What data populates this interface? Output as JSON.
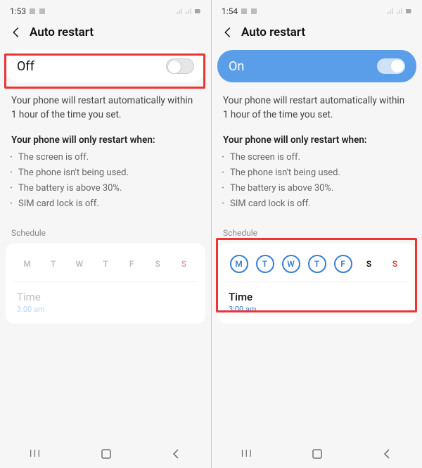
{
  "left": {
    "status_time": "1:53",
    "header_title": "Auto restart",
    "toggle_label": "Off",
    "desc": "Your phone will restart automatically within 1 hour of the time you set.",
    "subhead": "Your phone will only restart when:",
    "bullets": [
      "The screen is off.",
      "The phone isn't being used.",
      "The battery is above 30%.",
      "SIM card lock is off."
    ],
    "sched_label": "Schedule",
    "days": [
      "M",
      "T",
      "W",
      "T",
      "F",
      "S",
      "S"
    ],
    "time_label": "Time",
    "time_value": "3:00 am"
  },
  "right": {
    "status_time": "1:54",
    "header_title": "Auto restart",
    "toggle_label": "On",
    "desc": "Your phone will restart automatically within 1 hour of the time you set.",
    "subhead": "Your phone will only restart when:",
    "bullets": [
      "The screen is off.",
      "The phone isn't being used.",
      "The battery is above 30%.",
      "SIM card lock is off."
    ],
    "sched_label": "Schedule",
    "days": [
      "M",
      "T",
      "W",
      "T",
      "F",
      "S",
      "S"
    ],
    "time_label": "Time",
    "time_value": "3:00 am"
  }
}
